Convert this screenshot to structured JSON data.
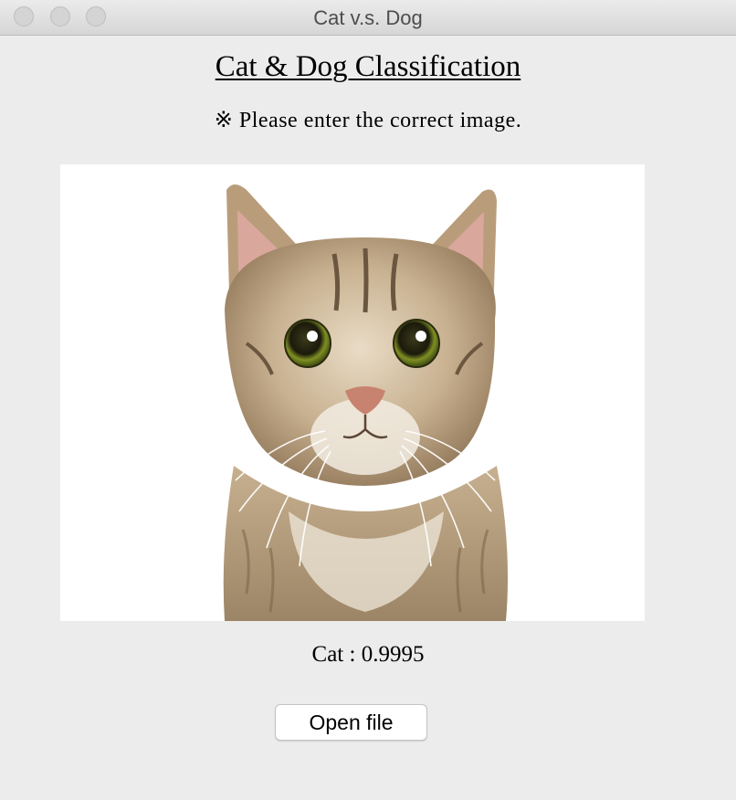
{
  "window": {
    "title": "Cat v.s. Dog"
  },
  "main": {
    "heading": "Cat & Dog Classification",
    "hint": "※ Please enter the correct image.",
    "result": "Cat : 0.9995",
    "open_button_label": "Open file"
  },
  "image": {
    "subject": "cat-photo",
    "background": "#ffffff"
  }
}
